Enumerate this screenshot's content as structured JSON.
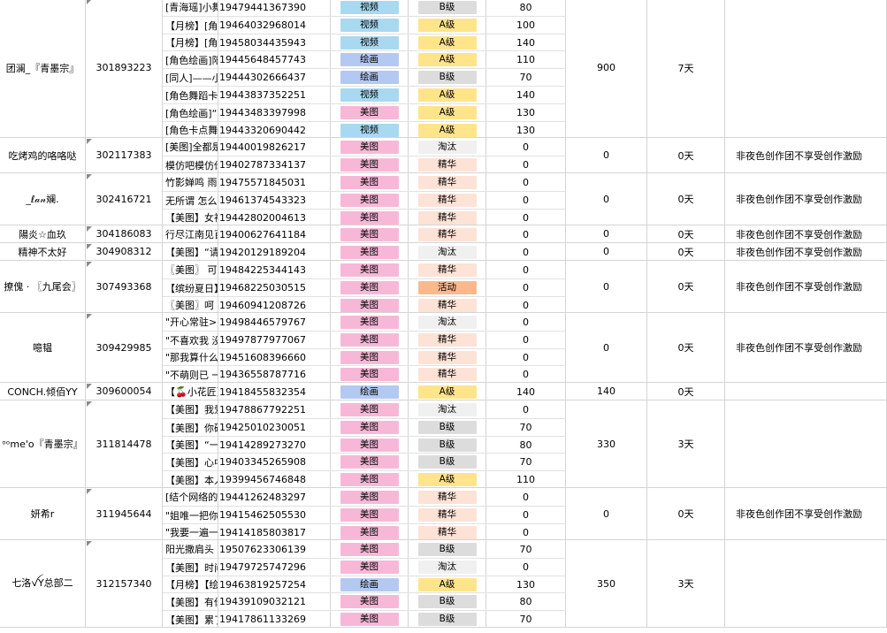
{
  "colors": {
    "type": {
      "视频": "#a8d9f0",
      "绘画": "#b4c9f2",
      "美图": "#f7b8d8"
    },
    "grade": {
      "B级": "#dcdcdc",
      "A级": "#ffe48a",
      "淘汰": "#f0f0f0",
      "精华": "#fde2d6",
      "活动": "#f9b98f"
    }
  },
  "groups": [
    {
      "name": "团澜_『青墨宗』",
      "uid": "301893223",
      "total": "900",
      "days": "7天",
      "note": "",
      "rows": [
        {
          "title": "[青海瑶]小舞一曲",
          "pid": "19479441367390",
          "type": "视频",
          "grade": "B级",
          "score": "80"
        },
        {
          "title": "【月榜】[角色卡",
          "pid": "19464032968014",
          "type": "视频",
          "grade": "A级",
          "score": "100"
        },
        {
          "title": "【月榜】[角色卡",
          "pid": "19458034435943",
          "type": "视频",
          "grade": "A级",
          "score": "140"
        },
        {
          "title": "[角色绘画]阳光,",
          "pid": "19445648457743",
          "type": "绘画",
          "grade": "A级",
          "score": "110"
        },
        {
          "title": "[同人]——小绿",
          "pid": "19444302666437",
          "type": "绘画",
          "grade": "B级",
          "score": "70"
        },
        {
          "title": "[角色舞蹈卡点]青",
          "pid": "19443837352251",
          "type": "视频",
          "grade": "A级",
          "score": "140"
        },
        {
          "title": "[角色绘画]“花很",
          "pid": "19443483397998",
          "type": "美图",
          "grade": "A级",
          "score": "130"
        },
        {
          "title": "[角色卡点舞蹈]",
          "pid": "19443320690442",
          "type": "视频",
          "grade": "A级",
          "score": "130"
        }
      ]
    },
    {
      "name": "吃烤鸡的咯咯哒",
      "uid": "302117383",
      "total": "0",
      "days": "0天",
      "note": "非夜色创作团不享受创作激励",
      "rows": [
        {
          "title": "[美图]全都是泡沫",
          "pid": "19440019826217",
          "type": "美图",
          "grade": "淘汰",
          "score": "0"
        },
        {
          "title": "模仿吧模仿你明",
          "pid": "19402787334137",
          "type": "美图",
          "grade": "精华",
          "score": "0"
        }
      ]
    },
    {
      "name": "_ℓ𝒶𝓃斓.",
      "uid": "302416721",
      "total": "0",
      "days": "0天",
      "note": "非夜色创作团不享受创作激励",
      "rows": [
        {
          "title": "竹影婵鸣 雨落如",
          "pid": "19475571845031",
          "type": "美图",
          "grade": "精华",
          "score": "0"
        },
        {
          "title": "无所谓 怎么了",
          "pid": "19461374543323",
          "type": "美图",
          "grade": "精华",
          "score": "0"
        },
        {
          "title": "【美图】女神我",
          "pid": "19442802004613",
          "type": "美图",
          "grade": "精华",
          "score": "0"
        }
      ]
    },
    {
      "name": "陽炎☆血玖",
      "uid": "304186083",
      "total": "0",
      "days": "0天",
      "note": "非夜色创作团不享受创作激励",
      "rows": [
        {
          "title": "行尽江南见百花",
          "pid": "19400627641184",
          "type": "美图",
          "grade": "精华",
          "score": "0"
        }
      ]
    },
    {
      "name": "精神不太好",
      "uid": "304908312",
      "total": "0",
      "days": "0天",
      "note": "非夜色创作团不享受创作激励",
      "rows": [
        {
          "title": "【美图】“请再多",
          "pid": "19420129189204",
          "type": "美图",
          "grade": "淘汰",
          "score": "0"
        }
      ]
    },
    {
      "name": "撩傀 · 〖九尾会〗",
      "uid": "307493368",
      "total": "0",
      "days": "0天",
      "note": "非夜色创作团不享受创作激励",
      "rows": [
        {
          "title": "〖美图〗 可 人",
          "pid": "19484225344143",
          "type": "美图",
          "grade": "精华",
          "score": "0"
        },
        {
          "title": "【缤纷夏日】“夏",
          "pid": "19468225030515",
          "type": "美图",
          "grade": "活动",
          "score": "0"
        },
        {
          "title": "〖美图〗呵 我要",
          "pid": "19460941208726",
          "type": "美图",
          "grade": "精华",
          "score": "0"
        }
      ]
    },
    {
      "name": "噫韫",
      "uid": "309429985",
      "total": "0",
      "days": "0天",
      "note": "非夜色创作团不享受创作激励",
      "rows": [
        {
          "title": "\"开心常驻>-<\"",
          "pid": "19498446579767",
          "type": "美图",
          "grade": "淘汰",
          "score": "0"
        },
        {
          "title": "\"不喜欢我 没品\"",
          "pid": "19497877977067",
          "type": "美图",
          "grade": "精华",
          "score": "0"
        },
        {
          "title": "\"那我算什么 算什",
          "pid": "19451608396660",
          "type": "美图",
          "grade": "精华",
          "score": "0"
        },
        {
          "title": "\"不萌则已 一萌惊",
          "pid": "19436558787716",
          "type": "美图",
          "grade": "精华",
          "score": "0"
        }
      ]
    },
    {
      "name": "CONCH.倾佰YY",
      "uid": "309600054",
      "total": "140",
      "days": "0天",
      "note": "",
      "rows": [
        {
          "title": "【🍒小花匠】",
          "pid": "19418455832354",
          "type": "绘画",
          "grade": "A级",
          "score": "140"
        }
      ]
    },
    {
      "name": "ᵒᵒme'o『青墨宗』",
      "uid": "311814478",
      "total": "330",
      "days": "3天",
      "note": "",
      "rows": [
        {
          "title": "【美图】我爱你",
          "pid": "19478867792251",
          "type": "美图",
          "grade": "淘汰",
          "score": "0"
        },
        {
          "title": "【美图】你确实",
          "pid": "19425010230051",
          "type": "美图",
          "grade": "B级",
          "score": "70"
        },
        {
          "title": "【美图】“一起去",
          "pid": "19414289273270",
          "type": "美图",
          "grade": "B级",
          "score": "80"
        },
        {
          "title": "【美图】心中若",
          "pid": "19403345265908",
          "type": "美图",
          "grade": "B级",
          "score": "70"
        },
        {
          "title": "【美图】本人有",
          "pid": "19399456746848",
          "type": "美图",
          "grade": "A级",
          "score": "110"
        }
      ]
    },
    {
      "name": "妍希r",
      "uid": "311945644",
      "total": "0",
      "days": "0天",
      "note": "非夜色创作团不享受创作激励",
      "rows": [
        {
          "title": "[结个网络的婚吧",
          "pid": "19441262483297",
          "type": "美图",
          "grade": "精华",
          "score": "0"
        },
        {
          "title": "\"姐唯一把你当成",
          "pid": "19415462505530",
          "type": "美图",
          "grade": "精华",
          "score": "0"
        },
        {
          "title": "\"我要一遍一遍的",
          "pid": "19414185803817",
          "type": "美图",
          "grade": "精华",
          "score": "0"
        }
      ]
    },
    {
      "name": "七洛ꪜY总部二",
      "uid": "312157340",
      "total": "350",
      "days": "3天",
      "note": "",
      "rows": [
        {
          "title": "阳光撒肩头 明媚",
          "pid": "19507623306139",
          "type": "美图",
          "grade": "B级",
          "score": "70"
        },
        {
          "title": "【美图】时间模",
          "pid": "19479725747296",
          "type": "美图",
          "grade": "淘汰",
          "score": "0"
        },
        {
          "title": "【月榜】【绘画】",
          "pid": "19463819257254",
          "type": "绘画",
          "grade": "A级",
          "score": "130"
        },
        {
          "title": "【美图】有你真",
          "pid": "19439109032121",
          "type": "美图",
          "grade": "B级",
          "score": "80"
        },
        {
          "title": "【美图】累了给",
          "pid": "19417861133269",
          "type": "美图",
          "grade": "B级",
          "score": "70"
        }
      ]
    }
  ]
}
